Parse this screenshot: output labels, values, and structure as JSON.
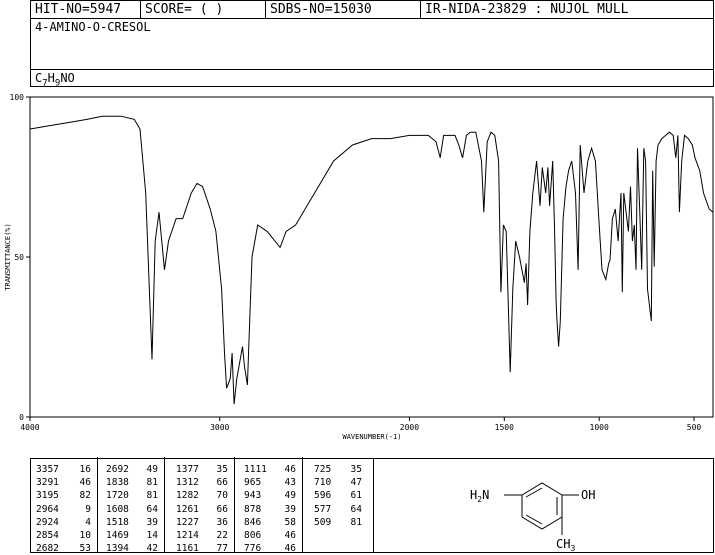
{
  "header": {
    "hit_no": "HIT-NO=5947",
    "score": "SCORE=  (   )",
    "sdbs_no": "SDBS-NO=15030",
    "ir_nida": "IR-NIDA-23829 : NUJOL MULL"
  },
  "compound": {
    "name": "4-AMINO-O-CRESOL",
    "formula_parts": [
      "C",
      "7",
      "H",
      "9",
      "NO"
    ]
  },
  "chart_data": {
    "type": "line",
    "xlabel": "WAVENUMBER(-1)",
    "ylabel": "TRANSMITTANCE(%)",
    "xlim": [
      4000,
      400
    ],
    "ylim": [
      0,
      100
    ],
    "x_ticks": [
      4000,
      3000,
      2000,
      1500,
      1000,
      500
    ],
    "y_ticks": [
      0,
      50,
      100
    ],
    "x": [
      4000,
      3900,
      3800,
      3700,
      3620,
      3520,
      3450,
      3420,
      3390,
      3357,
      3340,
      3320,
      3291,
      3270,
      3230,
      3195,
      3150,
      3120,
      3090,
      3050,
      3020,
      2990,
      2975,
      2964,
      2945,
      2935,
      2924,
      2910,
      2880,
      2870,
      2854,
      2830,
      2800,
      2750,
      2682,
      2650,
      2600,
      2500,
      2400,
      2300,
      2200,
      2100,
      2000,
      1950,
      1900,
      1860,
      1838,
      1820,
      1800,
      1760,
      1740,
      1720,
      1700,
      1680,
      1650,
      1620,
      1608,
      1590,
      1570,
      1550,
      1530,
      1518,
      1505,
      1490,
      1469,
      1455,
      1440,
      1420,
      1394,
      1385,
      1377,
      1365,
      1350,
      1330,
      1312,
      1300,
      1282,
      1270,
      1261,
      1245,
      1235,
      1227,
      1222,
      1214,
      1205,
      1190,
      1175,
      1161,
      1145,
      1125,
      1111,
      1100,
      1080,
      1060,
      1040,
      1020,
      1000,
      985,
      965,
      950,
      943,
      930,
      915,
      900,
      885,
      878,
      870,
      860,
      846,
      835,
      825,
      815,
      806,
      798,
      785,
      776,
      765,
      755,
      745,
      735,
      725,
      718,
      710,
      700,
      690,
      670,
      650,
      630,
      610,
      596,
      585,
      577,
      565,
      550,
      530,
      509,
      495,
      470,
      450,
      420,
      400
    ],
    "y": [
      90,
      91,
      92,
      93,
      94,
      94,
      93,
      90,
      70,
      18,
      55,
      64,
      46,
      55,
      62,
      62,
      70,
      73,
      72,
      65,
      58,
      40,
      20,
      9,
      12,
      20,
      4,
      12,
      22,
      16,
      10,
      50,
      60,
      58,
      53,
      58,
      60,
      70,
      80,
      85,
      87,
      87,
      88,
      88,
      88,
      86,
      81,
      88,
      88,
      88,
      85,
      81,
      88,
      89,
      89,
      80,
      64,
      86,
      89,
      88,
      80,
      39,
      60,
      58,
      14,
      40,
      55,
      50,
      42,
      48,
      35,
      58,
      70,
      80,
      66,
      78,
      70,
      78,
      66,
      80,
      58,
      36,
      30,
      22,
      30,
      62,
      72,
      77,
      80,
      70,
      46,
      85,
      70,
      80,
      84,
      80,
      60,
      46,
      43,
      48,
      49,
      62,
      65,
      55,
      70,
      39,
      70,
      65,
      58,
      72,
      55,
      60,
      46,
      84,
      62,
      46,
      84,
      80,
      40,
      35,
      30,
      77,
      47,
      80,
      85,
      87,
      88,
      89,
      88,
      81,
      88,
      64,
      80,
      88,
      87,
      85,
      81,
      77,
      70,
      65,
      64
    ]
  },
  "peak_table": [
    [
      [
        "3357",
        "16"
      ],
      [
        "3291",
        "46"
      ],
      [
        "3195",
        "82"
      ],
      [
        "2964",
        "9"
      ],
      [
        "2924",
        "4"
      ],
      [
        "2854",
        "10"
      ],
      [
        "2682",
        "53"
      ]
    ],
    [
      [
        "2692",
        "49"
      ],
      [
        "1838",
        "81"
      ],
      [
        "1720",
        "81"
      ],
      [
        "1608",
        "64"
      ],
      [
        "1518",
        "39"
      ],
      [
        "1469",
        "14"
      ],
      [
        "1394",
        "42"
      ]
    ],
    [
      [
        "1377",
        "35"
      ],
      [
        "1312",
        "66"
      ],
      [
        "1282",
        "70"
      ],
      [
        "1261",
        "66"
      ],
      [
        "1227",
        "36"
      ],
      [
        "1214",
        "22"
      ],
      [
        "1161",
        "77"
      ]
    ],
    [
      [
        "1111",
        "46"
      ],
      [
        "965",
        "43"
      ],
      [
        "943",
        "49"
      ],
      [
        "878",
        "39"
      ],
      [
        "846",
        "58"
      ],
      [
        "806",
        "46"
      ],
      [
        "776",
        "46"
      ]
    ],
    [
      [
        "725",
        "35"
      ],
      [
        "710",
        "47"
      ],
      [
        "596",
        "61"
      ],
      [
        "577",
        "64"
      ],
      [
        "509",
        "81"
      ]
    ]
  ],
  "structure": {
    "left_group": [
      "H",
      "2",
      "N"
    ],
    "right_group": "OH",
    "bottom_group": [
      "CH",
      "3"
    ]
  }
}
